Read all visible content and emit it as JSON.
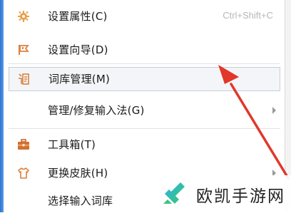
{
  "menu": {
    "items": [
      {
        "label": "设置属性(C)",
        "shortcut": "Ctrl+Shift+C",
        "icon": "gear-icon"
      },
      {
        "label": "设置向导(D)",
        "icon": "flag-icon"
      },
      {
        "label": "词库管理(M)",
        "icon": "dictionary-icon",
        "highlighted": true
      },
      {
        "label": "管理/修复输入法(G)",
        "has_submenu": true
      },
      {
        "label": "工具箱(T)",
        "icon": "toolbox-icon"
      },
      {
        "label": "更换皮肤(H)",
        "icon": "shirt-icon",
        "has_submenu": true
      },
      {
        "label": "选择输入词库"
      }
    ]
  },
  "watermark": {
    "text": "欧凯手游网"
  },
  "colors": {
    "accent_strip": "#2b73d2",
    "annotation_arrow": "#e2372b",
    "icon_orange": "#e0892c"
  }
}
